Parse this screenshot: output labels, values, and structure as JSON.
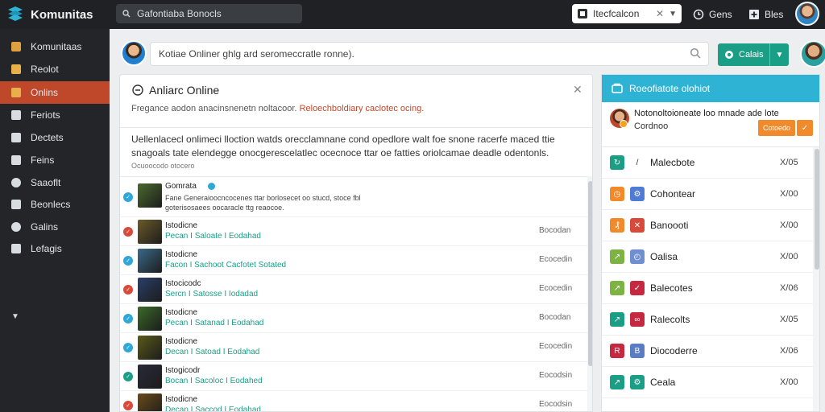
{
  "app": {
    "title": "Komunitas"
  },
  "topbar": {
    "search_text": "Gafontiaba Bonocls",
    "language": "Itecfcalcon",
    "link1": "Gens",
    "link2": "Bles"
  },
  "sidebar": {
    "items": [
      {
        "label": "Komunitaas",
        "icon": "home-icon"
      },
      {
        "label": "Reolot",
        "icon": "dashboard-icon"
      },
      {
        "label": "Onlins",
        "icon": "online-icon"
      },
      {
        "label": "Feriots",
        "icon": "feeds-icon"
      },
      {
        "label": "Dectets",
        "icon": "details-icon"
      },
      {
        "label": "Feins",
        "icon": "files-icon"
      },
      {
        "label": "Saaoflt",
        "icon": "search-icon"
      },
      {
        "label": "Beonlecs",
        "icon": "boards-icon"
      },
      {
        "label": "Galins",
        "icon": "globe-icon"
      },
      {
        "label": "Lefagis",
        "icon": "settings-icon"
      }
    ],
    "active_index": 2
  },
  "composer": {
    "placeholder": "Kotiae Onliner ghlg ard seromeccratle ronne).",
    "button_label": "Calais"
  },
  "feed": {
    "title": "Anliarc Online",
    "subtitle_plain": "Fregance aodon anacinsnenetn noltacoor.",
    "subtitle_highlight": "Reloechboldiary caclotec ocing.",
    "description": "Uellenlacecl onlimeci lloction watds orecclamnane cond opedlore walt foe snone racerfe maced ttie snagoals tate elendegge onocgerescelatlec ocecnoce ttar oe fatties oriolcamae deadle odentonls.",
    "description_meta": "Ocuoocodo otocero",
    "items": [
      {
        "title": "Gomrata",
        "meta": "",
        "desc": "Fane Generaioocncocenes ttar borlosecet oo stucd, stoce fbl goterisosaees oocaracle ttg reaocoe.",
        "time": "",
        "dot_color": "#2fa8d8",
        "thumb": "#4b6a2e",
        "featured": true
      },
      {
        "title": "Istodicne",
        "meta": "Pecan I Saloate I Eodahad",
        "desc": "",
        "time": "Bocodan",
        "dot_color": "#d84a3a",
        "thumb": "#6b5a2a",
        "featured": false
      },
      {
        "title": "Istodicne",
        "meta": "Facon I Sachoot Cacfotet Sotated",
        "desc": "",
        "time": "Ecocedin",
        "dot_color": "#2fa8d8",
        "thumb": "#3a6a8a",
        "featured": false
      },
      {
        "title": "Istocicodc",
        "meta": "Sercn I Satosse I Iodadad",
        "desc": "",
        "time": "Ecocedin",
        "dot_color": "#d84a3a",
        "thumb": "#2a3f6a",
        "featured": false
      },
      {
        "title": "Istodicne",
        "meta": "Pecan I Satanad I Eodahad",
        "desc": "",
        "time": "Bocodan",
        "dot_color": "#2fa8d8",
        "thumb": "#3b6a2a",
        "featured": false
      },
      {
        "title": "Istodicne",
        "meta": "Decan I Satoad I Eodahad",
        "desc": "",
        "time": "Ecocedin",
        "dot_color": "#2fa8d8",
        "thumb": "#5a5a1a",
        "featured": false
      },
      {
        "title": "Istogicodr",
        "meta": "Bocan I Sacoloc I Eodahed",
        "desc": "",
        "time": "Eocodsin",
        "dot_color": "#1a9e86",
        "thumb": "#2a2a3a",
        "featured": false
      },
      {
        "title": "Istodicne",
        "meta": "Decan I Saccod I Eodahad",
        "desc": "",
        "time": "Eocodsin",
        "dot_color": "#d84a3a",
        "thumb": "#6a4a1a",
        "featured": false
      }
    ]
  },
  "panel": {
    "title": "Roeofiatote olohiot",
    "user_title": "Notonoltoioneate loo mnade ade lote",
    "user_sub": "Cordnoo",
    "user_button": "Cotoedo",
    "rows": [
      {
        "label": "Malecbote",
        "value": "X/05",
        "c1": "#1a9e86",
        "c2": "",
        "g1": "↻",
        "g2": "/"
      },
      {
        "label": "Cohontear",
        "value": "X/00",
        "c1": "#f08a2a",
        "c2": "#4f7bd6",
        "g1": "◷",
        "g2": "⚙"
      },
      {
        "label": "Banoooti",
        "value": "X/00",
        "c1": "#f08a2a",
        "c2": "#d84a3a",
        "g1": "₰",
        "g2": "✕"
      },
      {
        "label": "Oalisa",
        "value": "X/00",
        "c1": "#7cb342",
        "c2": "#6f8fd0",
        "g1": "↗",
        "g2": "◴"
      },
      {
        "label": "Balecotes",
        "value": "X/06",
        "c1": "#7cb342",
        "c2": "#c62840",
        "g1": "↗",
        "g2": "✓"
      },
      {
        "label": "Ralecolts",
        "value": "X/05",
        "c1": "#1a9e86",
        "c2": "#c62840",
        "g1": "↗",
        "g2": "∞"
      },
      {
        "label": "Diocoderre",
        "value": "X/06",
        "c1": "#c62840",
        "c2": "#5b7cc4",
        "g1": "R",
        "g2": "B"
      },
      {
        "label": "Ceala",
        "value": "X/00",
        "c1": "#1a9e86",
        "c2": "#1a9e86",
        "g1": "↗",
        "g2": "⚙"
      }
    ]
  },
  "colors": {
    "accent": "#c0482a",
    "topbar": "#1f2124",
    "sidebar": "#232528",
    "green": "#1b9e86",
    "panel_header": "#2fb3d4",
    "orange": "#f08a2a"
  }
}
